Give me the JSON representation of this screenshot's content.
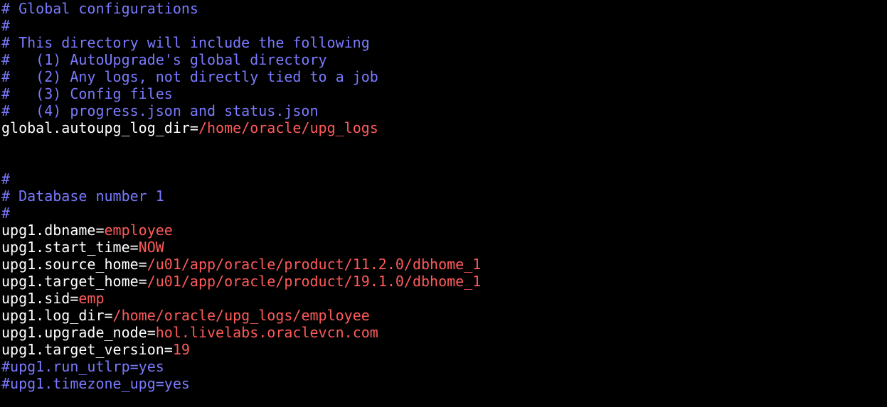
{
  "colors": {
    "background": "#000000",
    "comment": "#7a7aff",
    "key": "#ffffff",
    "value": "#ff5a5a"
  },
  "lines": [
    {
      "type": "comment",
      "text": "# Global configurations"
    },
    {
      "type": "comment",
      "text": "#"
    },
    {
      "type": "comment",
      "text": "# This directory will include the following"
    },
    {
      "type": "comment",
      "text": "#   (1) AutoUpgrade's global directory"
    },
    {
      "type": "comment",
      "text": "#   (2) Any logs, not directly tied to a job"
    },
    {
      "type": "comment",
      "text": "#   (3) Config files"
    },
    {
      "type": "comment",
      "text": "#   (4) progress.json and status.json"
    },
    {
      "type": "kv",
      "key": "global.autoupg_log_dir=",
      "value": "/home/oracle/upg_logs"
    },
    {
      "type": "blank",
      "text": ""
    },
    {
      "type": "blank",
      "text": ""
    },
    {
      "type": "comment",
      "text": "#"
    },
    {
      "type": "comment",
      "text": "# Database number 1"
    },
    {
      "type": "comment",
      "text": "#"
    },
    {
      "type": "kv",
      "key": "upg1.dbname=",
      "value": "employee"
    },
    {
      "type": "kv",
      "key": "upg1.start_time=",
      "value": "NOW"
    },
    {
      "type": "kv",
      "key": "upg1.source_home=",
      "value": "/u01/app/oracle/product/11.2.0/dbhome_1"
    },
    {
      "type": "kv",
      "key": "upg1.target_home=",
      "value": "/u01/app/oracle/product/19.1.0/dbhome_1"
    },
    {
      "type": "kv",
      "key": "upg1.sid=",
      "value": "emp"
    },
    {
      "type": "kv",
      "key": "upg1.log_dir=",
      "value": "/home/oracle/upg_logs/employee"
    },
    {
      "type": "kv",
      "key": "upg1.upgrade_node=",
      "value": "hol.livelabs.oraclevcn.com"
    },
    {
      "type": "kv",
      "key": "upg1.target_version=",
      "value": "19"
    },
    {
      "type": "comment",
      "text": "#upg1.run_utlrp=yes"
    },
    {
      "type": "comment",
      "text": "#upg1.timezone_upg=yes"
    }
  ]
}
